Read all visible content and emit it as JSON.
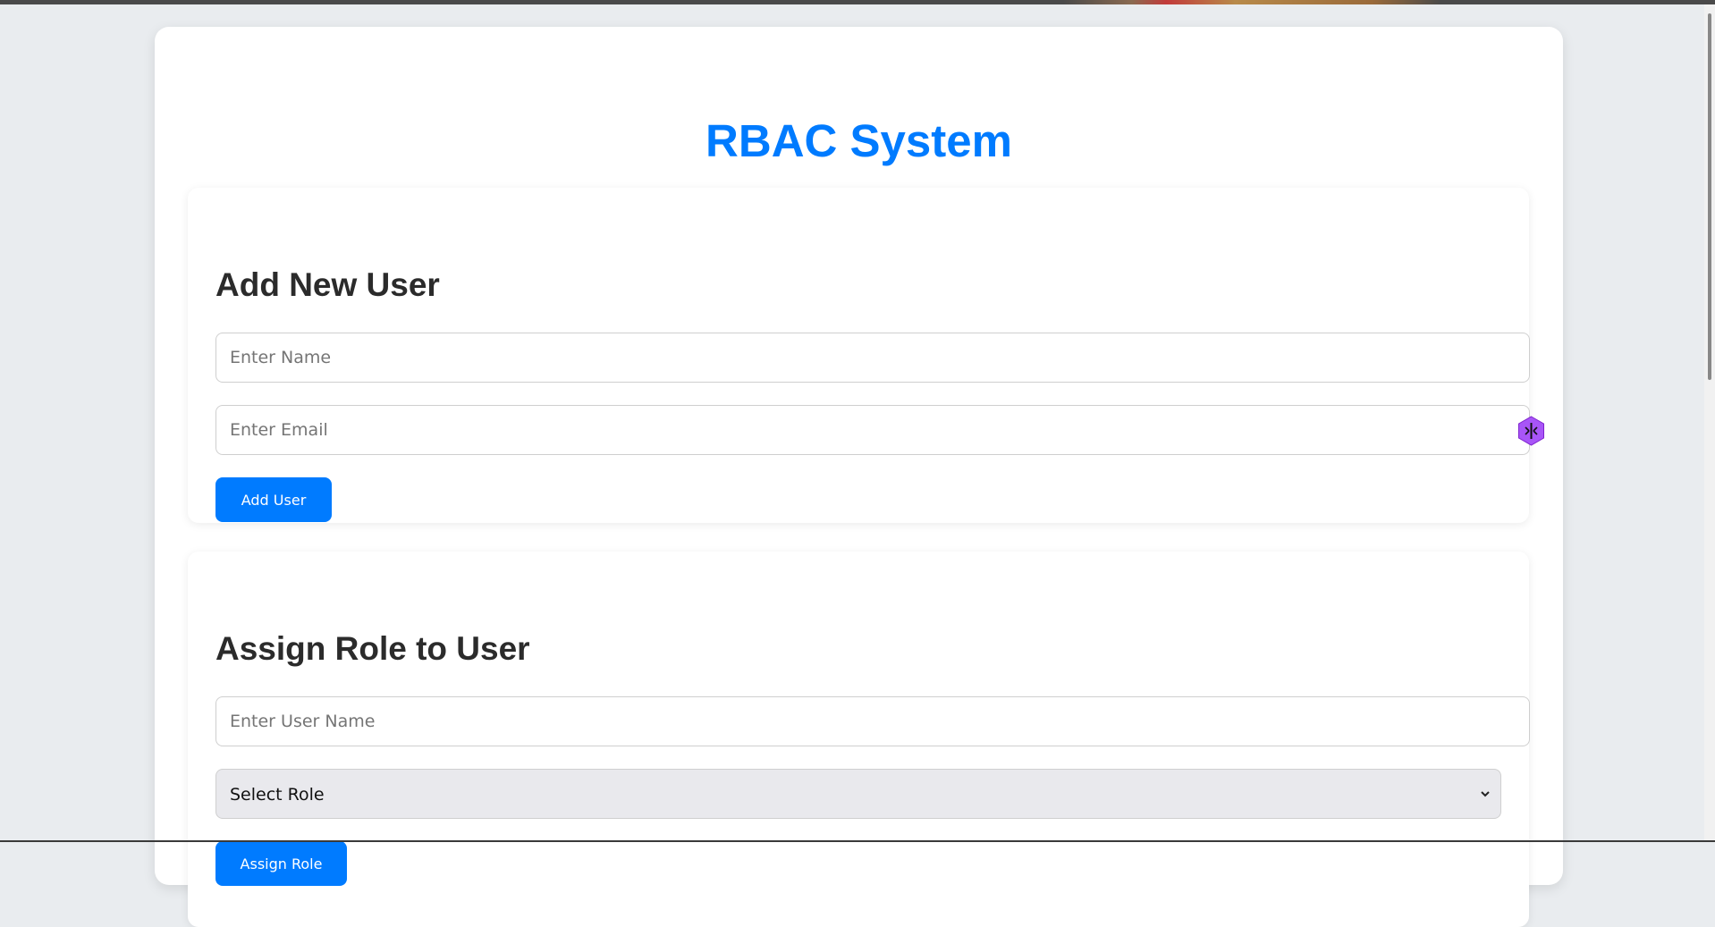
{
  "page": {
    "title": "RBAC System"
  },
  "add_user": {
    "heading": "Add New User",
    "name_placeholder": "Enter Name",
    "email_placeholder": "Enter Email",
    "button_label": "Add User"
  },
  "assign_role": {
    "heading": "Assign Role to User",
    "username_placeholder": "Enter User Name",
    "role_select_value": "Select Role",
    "button_label": "Assign Role"
  },
  "colors": {
    "accent": "#007bff",
    "background": "#e9ecef",
    "extension_icon": "#a855f7"
  },
  "icons": {
    "email_extension": "password-manager-extension-icon",
    "select_chevron": "chevron-down-icon"
  }
}
